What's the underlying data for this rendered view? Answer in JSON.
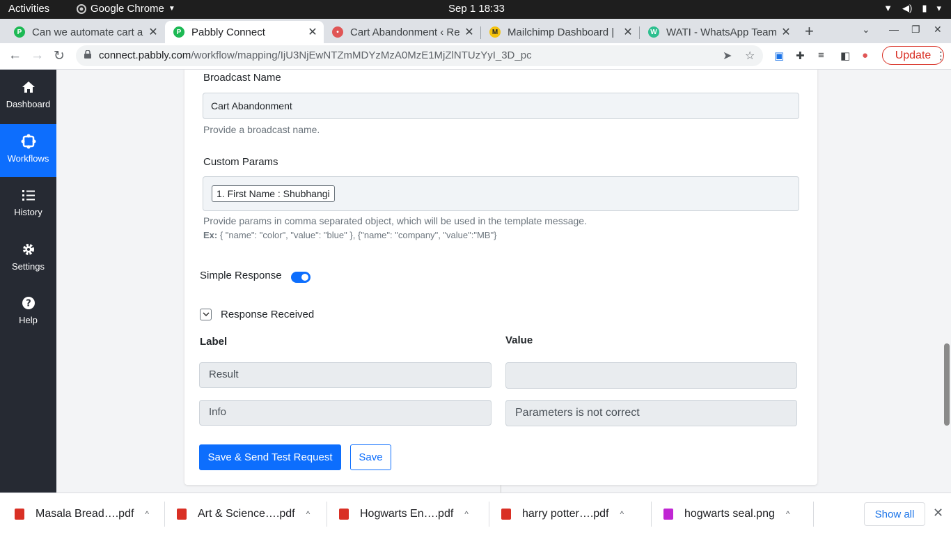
{
  "os": {
    "activities": "Activities",
    "app_name": "Google Chrome",
    "clock": "Sep 1  18:33"
  },
  "tabs": [
    {
      "title": "Can we automate cart a",
      "favicon_color": "#1db954",
      "favicon": "P"
    },
    {
      "title": "Pabbly Connect",
      "favicon_color": "#1db954",
      "favicon": "P",
      "active": true
    },
    {
      "title": "Cart Abandonment ‹ Re",
      "favicon_color": "#e05555",
      "favicon": "•"
    },
    {
      "title": "Mailchimp Dashboard | ",
      "favicon_color": "#f4c20d",
      "favicon": "M"
    },
    {
      "title": "WATI - WhatsApp Team ",
      "favicon_color": "#2dbf8f",
      "favicon": "W"
    }
  ],
  "address_bar": {
    "url_host": "connect.pabbly.com",
    "url_path": "/workflow/mapping/IjU3NjEwNTZmMDYzMzA0MzE1MjZlNTUzYyI_3D_pc",
    "update_label": "Update"
  },
  "sidebar": {
    "items": [
      {
        "label": "Dashboard",
        "icon": "home-icon"
      },
      {
        "label": "Workflows",
        "icon": "workflow-icon",
        "active": true
      },
      {
        "label": "History",
        "icon": "list-icon"
      },
      {
        "label": "Settings",
        "icon": "gear-icon"
      },
      {
        "label": "Help",
        "icon": "help-icon"
      }
    ]
  },
  "form": {
    "broadcast_name_label": "Broadcast Name",
    "broadcast_name_value": "Cart Abandonment",
    "broadcast_name_help": "Provide a broadcast name.",
    "custom_params_label": "Custom Params",
    "custom_params_tag": "1. First Name : Shubhangi",
    "custom_params_help": "Provide params in comma separated object, which will be used in the template message.",
    "custom_params_example_prefix": "Ex:",
    "custom_params_example": " { \"name\": \"color\", \"value\": \"blue\" }, {\"name\": \"company\", \"value\":\"MB\"}",
    "simple_response_label": "Simple Response",
    "simple_response_on": true,
    "response_received_label": "Response Received",
    "label_header": "Label",
    "value_header": "Value",
    "rows": [
      {
        "label": "Result",
        "value": ""
      },
      {
        "label": "Info",
        "value": "Parameters is not correct"
      }
    ],
    "save_send_label": "Save & Send Test Request",
    "save_label": "Save"
  },
  "downloads": {
    "items": [
      {
        "name": "Masala Bread….pdf",
        "type": "pdf"
      },
      {
        "name": "Art & Science….pdf",
        "type": "pdf"
      },
      {
        "name": "Hogwarts En….pdf",
        "type": "pdf"
      },
      {
        "name": "harry potter….pdf",
        "type": "pdf"
      },
      {
        "name": "hogwarts seal.png",
        "type": "image"
      }
    ],
    "show_all_label": "Show all"
  }
}
